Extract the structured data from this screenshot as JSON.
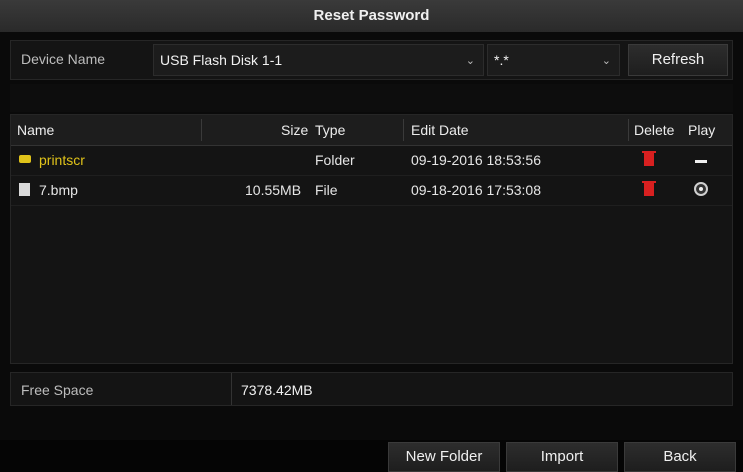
{
  "window": {
    "title": "Reset Password"
  },
  "toolbar": {
    "device_label": "Device Name",
    "device_value": "USB Flash Disk 1-1",
    "filter_value": "*.*",
    "refresh_label": "Refresh"
  },
  "table": {
    "columns": {
      "name": "Name",
      "size": "Size",
      "type": "Type",
      "edit_date": "Edit Date",
      "delete": "Delete",
      "play": "Play"
    },
    "rows": [
      {
        "name": "printscr",
        "size": "",
        "type": "Folder",
        "edit_date": "09-19-2016 18:53:56",
        "kind": "folder",
        "play": "none"
      },
      {
        "name": "7.bmp",
        "size": "10.55MB",
        "type": "File",
        "edit_date": "09-18-2016 17:53:08",
        "kind": "file",
        "play": "play"
      }
    ]
  },
  "free_space": {
    "label": "Free Space",
    "value": "7378.42MB"
  },
  "footer": {
    "new_folder": "New Folder",
    "import": "Import",
    "back": "Back"
  },
  "colors": {
    "folder_text": "#e0c31a",
    "delete_icon": "#d82020"
  }
}
